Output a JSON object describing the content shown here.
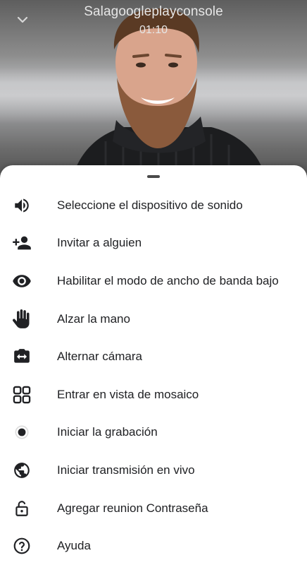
{
  "call": {
    "title": "Salagoogleplayconsole",
    "timer": "01:10"
  },
  "menu": {
    "items": [
      {
        "label": "Seleccione el dispositivo de sonido",
        "icon": "speaker-icon"
      },
      {
        "label": "Invitar a alguien",
        "icon": "add-person-icon"
      },
      {
        "label": "Habilitar el modo de ancho de banda bajo",
        "icon": "eye-icon"
      },
      {
        "label": "Alzar la mano",
        "icon": "hand-icon"
      },
      {
        "label": "Alternar cámara",
        "icon": "switch-camera-icon"
      },
      {
        "label": "Entrar en vista de mosaico",
        "icon": "tile-view-icon"
      },
      {
        "label": "Iniciar la grabación",
        "icon": "record-icon"
      },
      {
        "label": "Iniciar transmisión en vivo",
        "icon": "globe-icon"
      },
      {
        "label": "Agregar reunion Contraseña",
        "icon": "lock-icon"
      },
      {
        "label": "Ayuda",
        "icon": "help-icon"
      }
    ]
  }
}
